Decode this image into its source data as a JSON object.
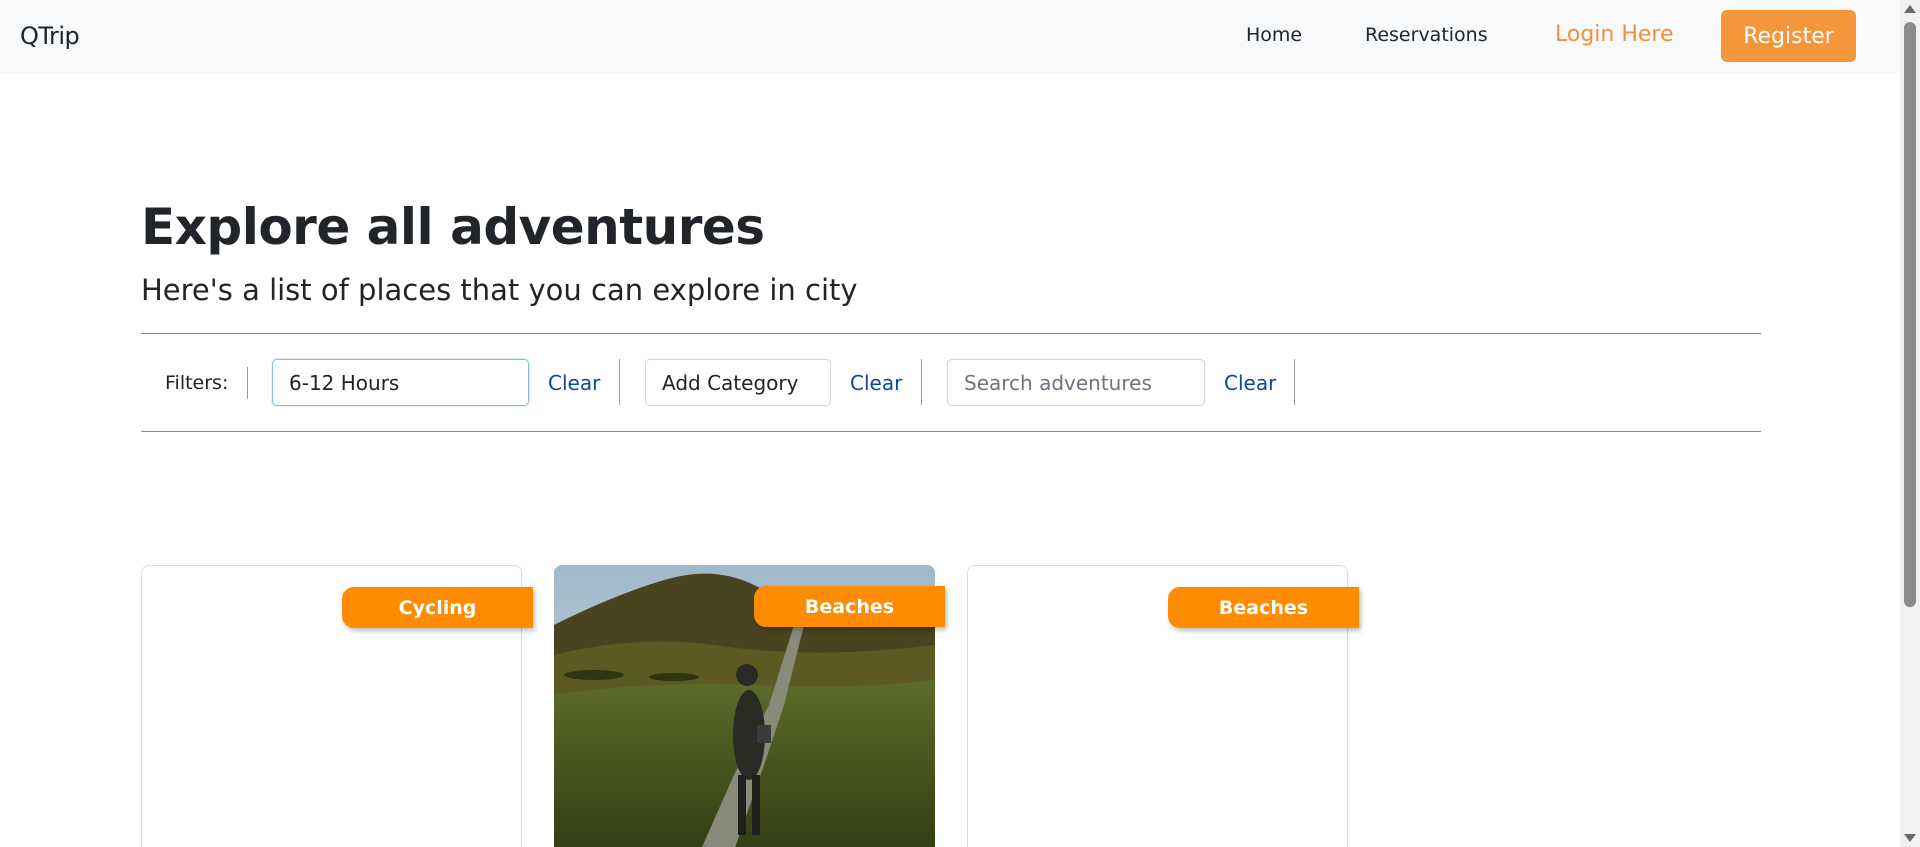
{
  "navbar": {
    "brand": "QTrip",
    "home": "Home",
    "reservations": "Reservations",
    "login": "Login Here",
    "register": "Register"
  },
  "header": {
    "title": "Explore all adventures",
    "subtitle": "Here's a list of places that you can explore in city"
  },
  "filters": {
    "label": "Filters:",
    "duration_value": "6-12 Hours",
    "category_value": "Add Category",
    "search_placeholder": "Search adventures",
    "clear_label": "Clear"
  },
  "cards": [
    {
      "category": "Cycling",
      "has_image": false
    },
    {
      "category": "Beaches",
      "has_image": true
    },
    {
      "category": "Beaches",
      "has_image": false
    }
  ],
  "colors": {
    "accent": "#f5963c",
    "badge": "#ff8c00",
    "link": "#0d47a1"
  }
}
